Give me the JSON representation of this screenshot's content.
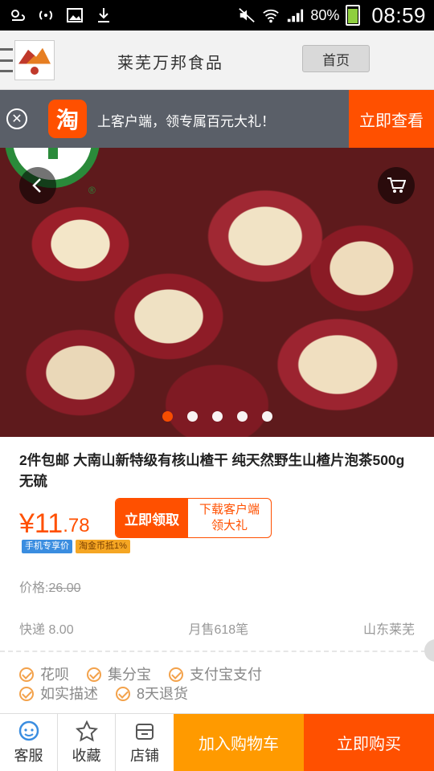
{
  "status_bar": {
    "battery": "80%",
    "time": "08:59",
    "battery_level": 0.8,
    "icons": [
      "weather-icon",
      "wifi-hotspot-icon",
      "image-icon",
      "download-icon",
      "mute-icon",
      "wifi-icon",
      "signal-icon",
      "battery-icon"
    ]
  },
  "header": {
    "shop_name": "莱芜万邦食品",
    "home_button": "首页",
    "logo_alt_icon": "shop-logo-icon"
  },
  "banner": {
    "logo_char": "淘",
    "text": "上客户端，领专属百元大礼！",
    "cta": "立即查看"
  },
  "product": {
    "title": "2件包邮 大南山新特级有核山楂干 纯天然野生山楂片泡茶500g无硫",
    "price_symbol": "¥",
    "price_int": "11",
    "price_dec": ".78",
    "coupon_button": "立即领取",
    "coupon_text_line1": "下载客户端",
    "coupon_text_line2": "领大礼",
    "tag_mobile": "手机专享价",
    "tag_gold": "淘金币抵1%",
    "orig_price_label": "价格:",
    "orig_price_value": "26.00",
    "shipping": "快递 8.00",
    "monthly_sales": "月售618笔",
    "location": "山东莱芜",
    "carousel_total": 5,
    "carousel_active": 1
  },
  "services": {
    "row1": [
      "花呗",
      "集分宝",
      "支付宝支付"
    ],
    "row2": [
      "如实描述",
      "8天退货"
    ]
  },
  "bottom_bar": {
    "service": "客服",
    "favorite": "收藏",
    "store": "店铺",
    "add_to_cart": "加入购物车",
    "buy_now": "立即购买"
  },
  "colors": {
    "accent": "#ff5000",
    "cart": "#ff9a00",
    "banner_bg": "#5a5f68"
  }
}
